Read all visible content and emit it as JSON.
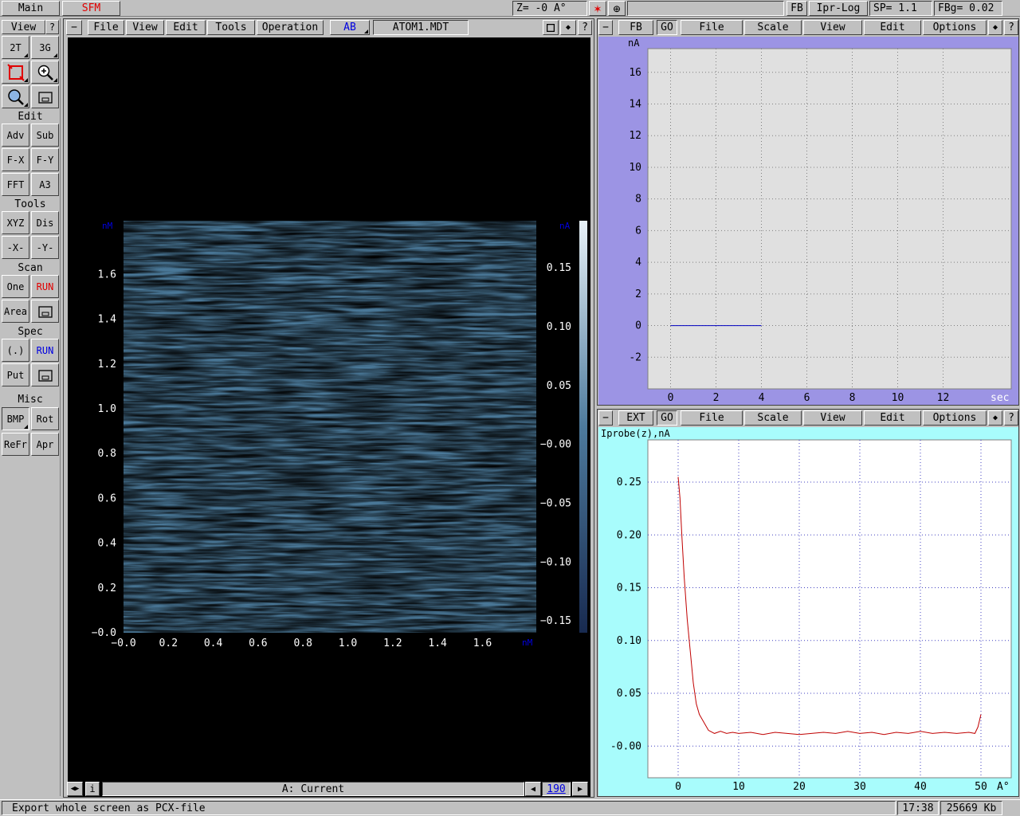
{
  "topbar": {
    "main_label": "Main",
    "sfm_label": "SFM",
    "z_readout": "Z=     -0 A°",
    "fb_label": "FB",
    "ipr_label": "Ipr-Log",
    "sp_readout": "SP=  1.1",
    "fbg_readout": "FBg= 0.02"
  },
  "left_toolbar": {
    "view_label": "View",
    "help_label": "?",
    "btn_2t": "2T",
    "btn_3g": "3G",
    "edit_label": "Edit",
    "btn_adv": "Adv",
    "btn_sub": "Sub",
    "btn_fx": "F-X",
    "btn_fy": "F-Y",
    "btn_fft": "FFT",
    "btn_a3": "A3",
    "tools_label": "Tools",
    "btn_xyz": "XYZ",
    "btn_dis": "Dis",
    "btn_x": "-X-",
    "btn_y": "-Y-",
    "scan_label": "Scan",
    "btn_one": "One",
    "btn_run_scan": "RUN",
    "btn_area": "Area",
    "spec_label": "Spec",
    "btn_point": "(.)",
    "btn_run_spec": "RUN",
    "btn_put": "Put",
    "misc_label": "Misc",
    "btn_bmp": "BMP",
    "btn_rot": "Rot",
    "btn_refr": "ReFr",
    "btn_apr": "Apr"
  },
  "image_window": {
    "minimize": "−",
    "menu": [
      "File",
      "View",
      "Edit",
      "Tools",
      "Operation"
    ],
    "ab_label": "AB",
    "filename": "ATOM1.MDT",
    "help": "?",
    "x_unit": "nM",
    "y_unit": "nM",
    "colorbar_unit": "nA",
    "y_ticks": [
      "1.6",
      "1.4",
      "1.2",
      "1.0",
      "0.8",
      "0.6",
      "0.4",
      "0.2",
      "−0.0"
    ],
    "x_ticks": [
      "−0.0",
      "0.2",
      "0.4",
      "0.6",
      "0.8",
      "1.0",
      "1.2",
      "1.4",
      "1.6"
    ],
    "colorbar_ticks": [
      "0.15",
      "0.10",
      "0.05",
      "−0.00",
      "−0.05",
      "−0.10",
      "−0.15"
    ],
    "info_label": "i",
    "channel_label": "A: Current",
    "frame_number": "190"
  },
  "fb_window": {
    "minimize": "−",
    "mode": "FB",
    "go": "GO",
    "menu": [
      "File",
      "Scale",
      "View",
      "Edit",
      "Options"
    ],
    "help": "?",
    "ylabel": "nA",
    "xlabel": "sec",
    "accent": "#9c94e4"
  },
  "ext_window": {
    "minimize": "−",
    "mode": "EXT",
    "go": "GO",
    "menu": [
      "File",
      "Scale",
      "View",
      "Edit",
      "Options"
    ],
    "help": "?",
    "ylabel": "Iprobe(z),nA",
    "xlabel": "A°",
    "accent": "#a8fcfc"
  },
  "chart_data": [
    {
      "type": "line",
      "ylabel": "nA",
      "xlabel": "sec",
      "xlim": [
        -1,
        15
      ],
      "ylim": [
        -4,
        17.5
      ],
      "x_ticks": [
        0,
        2,
        4,
        6,
        8,
        10,
        12
      ],
      "y_ticks": [
        16,
        14,
        12,
        10,
        8,
        6,
        4,
        2,
        0,
        -2
      ],
      "grid": true,
      "series": [
        {
          "x": [
            0,
            4
          ],
          "y": [
            0,
            0
          ],
          "color": "#0000c0"
        }
      ]
    },
    {
      "type": "line",
      "ylabel": "Iprobe(z),nA",
      "xlabel": "A°",
      "xlim": [
        -5,
        55
      ],
      "ylim": [
        -0.03,
        0.29
      ],
      "x_ticks": [
        0,
        10,
        20,
        30,
        40,
        50
      ],
      "y_ticks": [
        "0.25",
        "0.20",
        "0.15",
        "0.10",
        "0.05",
        "-0.00"
      ],
      "grid": true,
      "series": [
        {
          "color": "#c00000",
          "x": [
            0,
            0.3,
            0.6,
            1,
            1.5,
            2,
            2.5,
            3,
            3.5,
            4,
            5,
            6,
            7,
            8,
            9,
            10,
            12,
            14,
            16,
            18,
            20,
            22,
            24,
            26,
            28,
            30,
            32,
            34,
            36,
            38,
            40,
            42,
            44,
            46,
            48,
            49,
            49.5,
            50
          ],
          "y": [
            0.255,
            0.235,
            0.2,
            0.16,
            0.12,
            0.09,
            0.06,
            0.04,
            0.03,
            0.025,
            0.015,
            0.012,
            0.014,
            0.012,
            0.013,
            0.012,
            0.013,
            0.011,
            0.013,
            0.012,
            0.011,
            0.012,
            0.013,
            0.012,
            0.014,
            0.012,
            0.013,
            0.011,
            0.013,
            0.012,
            0.014,
            0.012,
            0.013,
            0.012,
            0.013,
            0.012,
            0.018,
            0.03
          ]
        }
      ]
    }
  ],
  "statusbar": {
    "message": "Export whole screen as PCX-file",
    "time": "17:38",
    "memory": "25669 Kb"
  }
}
